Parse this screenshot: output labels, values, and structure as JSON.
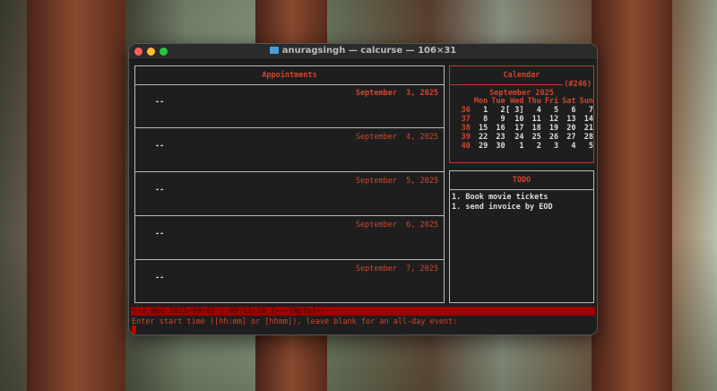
{
  "window": {
    "title": "anuragsingh — calcurse — 106×31"
  },
  "appointments": {
    "title": "Appointments",
    "days": [
      {
        "date": "September  3, 2025",
        "entry": "--"
      },
      {
        "date": "September  4, 2025",
        "entry": "--"
      },
      {
        "date": "September  5, 2025",
        "entry": "--"
      },
      {
        "date": "September  6, 2025",
        "entry": "--"
      },
      {
        "date": "September  7, 2025",
        "entry": "--"
      }
    ]
  },
  "calendar": {
    "title": "Calendar",
    "day_of_year": "(#246)",
    "month": "September 2025",
    "weekdays": [
      "Mon",
      "Tue",
      "Wed",
      "Thu",
      "Fri",
      "Sat",
      "Sun"
    ],
    "weeks": [
      {
        "num": "36",
        "days": [
          "1",
          "2",
          "[ 3]",
          "4",
          "5",
          "6",
          "7"
        ]
      },
      {
        "num": "37",
        "days": [
          "8",
          "9",
          "10",
          "11",
          "12",
          "13",
          "14"
        ]
      },
      {
        "num": "38",
        "days": [
          "15",
          "16",
          "17",
          "18",
          "19",
          "20",
          "21"
        ]
      },
      {
        "num": "39",
        "days": [
          "22",
          "23",
          "24",
          "25",
          "26",
          "27",
          "28"
        ]
      },
      {
        "num": "40",
        "days": [
          "29",
          "30",
          "1",
          "2",
          "3",
          "4",
          "5"
        ]
      }
    ]
  },
  "todo": {
    "title": "TODO",
    "items": [
      "1. Book movie tickets",
      "1. send invoice by EOD"
    ]
  },
  "status_bar": "--[ Wed 2025-09-03 | 09:13:18 ]---(Apts)---",
  "prompt": "Enter start time ([hh:mm] or [hhmm]), leave blank for an all-day event:",
  "colors": {
    "accent": "#d2452e",
    "status_bg": "#a00000",
    "terminal_bg": "#1e1e1e"
  }
}
